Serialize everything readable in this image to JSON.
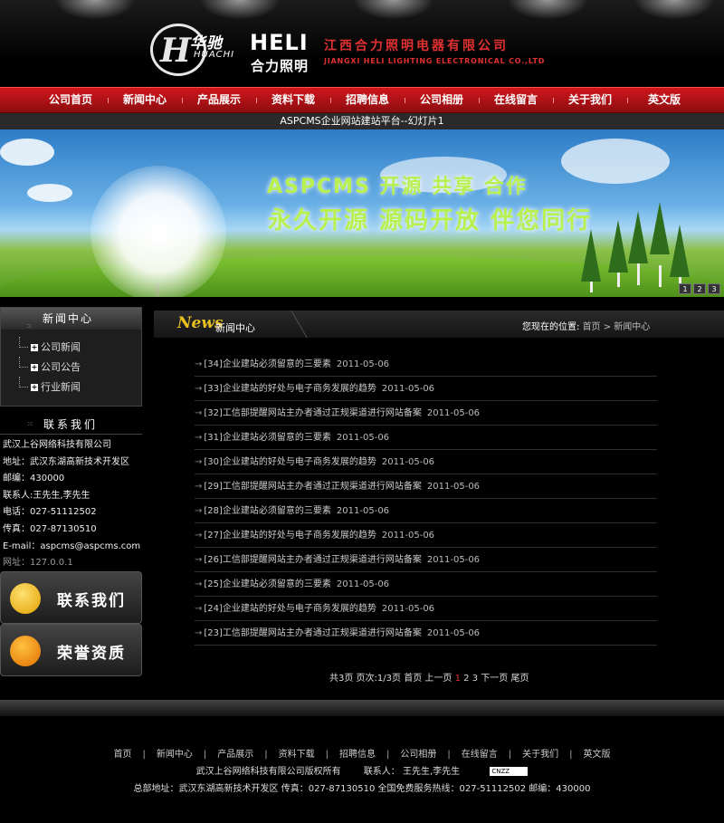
{
  "header": {
    "logo_glyph": "H",
    "logo_cn": "华驰",
    "logo_pinyin": "HUACHI",
    "brand_en": "HELI",
    "brand_cn": "合力照明",
    "company_cn": "江西合力照明电器有限公司",
    "company_en": "JIANGXI HELI LIGHTING ELECTRONICAL CO.,LTD"
  },
  "nav": {
    "items": [
      "公司首页",
      "新闻中心",
      "产品展示",
      "资料下载",
      "招聘信息",
      "公司相册",
      "在线留言",
      "关于我们",
      "英文版"
    ]
  },
  "banner": {
    "slide_title": "ASPCMS企业网站建站平台--幻灯片1",
    "line1": "ASPCMS 开源  共享  合作",
    "line2": "永久开源  源码开放  伴您同行",
    "slide_numbers": [
      "1",
      "2",
      "3"
    ]
  },
  "sidebar": {
    "news_title": "新闻中心",
    "categories": [
      "公司新闻",
      "公司公告",
      "行业新闻"
    ],
    "contact_title": "联系我们",
    "contact": {
      "company": "武汉上谷网络科技有限公司",
      "address": "地址：武汉东湖高新技术开发区",
      "postcode": "邮编：430000",
      "person": "联系人:王先生,李先生",
      "phone": "电话：027-51112502",
      "fax": "传真：027-87130510",
      "email": "E-mail：aspcms@aspcms.com",
      "website": "网址：127.0.0.1"
    },
    "button_contact": "联系我们",
    "button_honor": "荣誉资质"
  },
  "main": {
    "news_logo": "News",
    "section_title": "新闻中心",
    "breadcrumb_label": "您现在的位置:",
    "breadcrumb_path": "首页 > 新闻中心",
    "arrow": "→",
    "news": [
      {
        "title": "[34]企业建站必须留意的三要素",
        "date": "2011-05-06"
      },
      {
        "title": "[33]企业建站的好处与电子商务发展的趋势",
        "date": "2011-05-06"
      },
      {
        "title": "[32]工信部提醒网站主办者通过正规渠道进行网站备案",
        "date": "2011-05-06"
      },
      {
        "title": "[31]企业建站必须留意的三要素",
        "date": "2011-05-06"
      },
      {
        "title": "[30]企业建站的好处与电子商务发展的趋势",
        "date": "2011-05-06"
      },
      {
        "title": "[29]工信部提醒网站主办者通过正规渠道进行网站备案",
        "date": "2011-05-06"
      },
      {
        "title": "[28]企业建站必须留意的三要素",
        "date": "2011-05-06"
      },
      {
        "title": "[27]企业建站的好处与电子商务发展的趋势",
        "date": "2011-05-06"
      },
      {
        "title": "[26]工信部提醒网站主办者通过正规渠道进行网站备案",
        "date": "2011-05-06"
      },
      {
        "title": "[25]企业建站必须留意的三要素",
        "date": "2011-05-06"
      },
      {
        "title": "[24]企业建站的好处与电子商务发展的趋势",
        "date": "2011-05-06"
      },
      {
        "title": "[23]工信部提醒网站主办者通过正规渠道进行网站备案",
        "date": "2011-05-06"
      }
    ],
    "pager": {
      "summary": "共3页 页次:1/3页",
      "first": "首页",
      "prev": "上一页",
      "current": "1",
      "pages": [
        "2",
        "3"
      ],
      "next": "下一页",
      "last": "尾页"
    }
  },
  "footer": {
    "nav": [
      "首页",
      "新闻中心",
      "产品展示",
      "资料下载",
      "招聘信息",
      "公司相册",
      "在线留言",
      "关于我们",
      "英文版"
    ],
    "separator": "|",
    "copyright": "武汉上谷网络科技有限公司版权所有",
    "contact_person": "联系人： 王先生,李先生",
    "cnzz": "CNZZ",
    "address_line": "总部地址：武汉东湖高新技术开发区    传真：027-87130510    全国免费服务热线：027-51112502    邮编：430000"
  },
  "colors": {
    "nav_red": "#d0161b",
    "accent_red": "#e03030",
    "news_gold": "#e8c020",
    "banner_green": "#b8f050"
  }
}
